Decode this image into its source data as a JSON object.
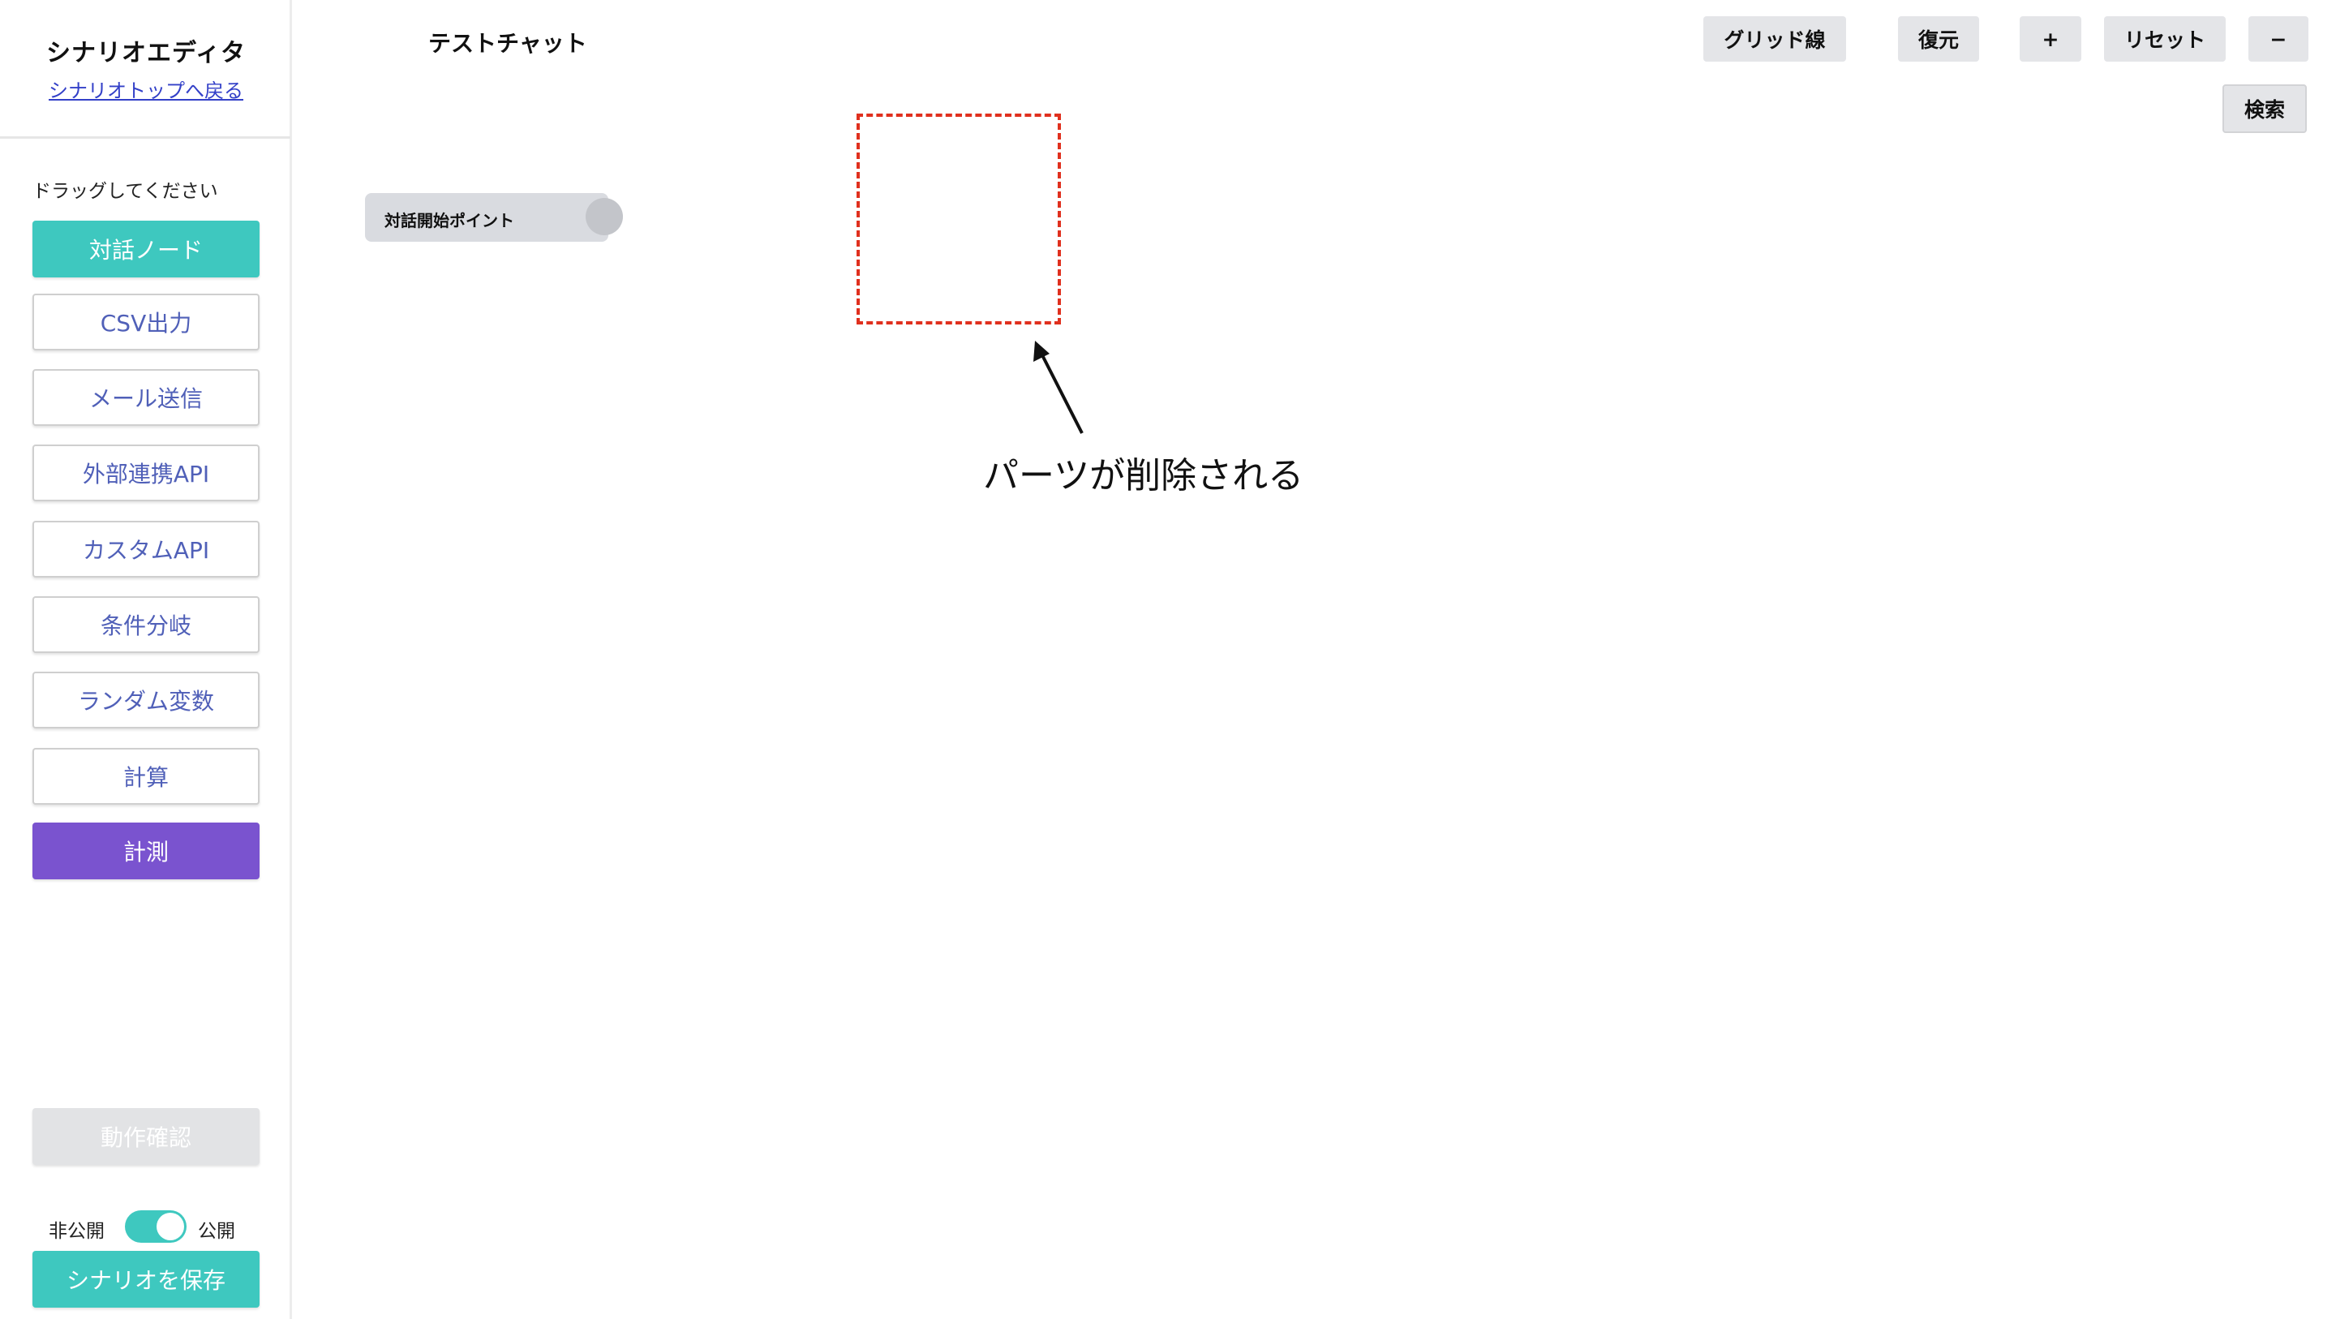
{
  "sidebar": {
    "title": "シナリオエディタ",
    "back_link": "シナリオトップへ戻る",
    "drag_hint": "ドラッグしてください",
    "palette": [
      {
        "label": "対話ノード",
        "style": "teal"
      },
      {
        "label": "CSV出力",
        "style": "outline"
      },
      {
        "label": "メール送信",
        "style": "outline"
      },
      {
        "label": "外部連携API",
        "style": "outline"
      },
      {
        "label": "カスタムAPI",
        "style": "outline"
      },
      {
        "label": "条件分岐",
        "style": "outline"
      },
      {
        "label": "ランダム変数",
        "style": "outline"
      },
      {
        "label": "計算",
        "style": "outline"
      },
      {
        "label": "計測",
        "style": "purple"
      }
    ],
    "run_check": "動作確認",
    "toggle": {
      "off_label": "非公開",
      "on_label": "公開",
      "state": "on"
    },
    "save_button": "シナリオを保存"
  },
  "header": {
    "chat_title": "テストチャット",
    "toolbar": {
      "grid": "グリッド線",
      "restore": "復元",
      "zoom_in": "+",
      "reset": "リセット",
      "zoom_out": "−",
      "search": "検索"
    }
  },
  "canvas": {
    "start_node": "対話開始ポイント",
    "annotation": "パーツが削除される"
  },
  "colors": {
    "teal": "#3ec8bf",
    "purple": "#7a53cf",
    "link": "#3340c8",
    "dashed_highlight": "#e0301e",
    "toolbar_bg": "#e4e5e8"
  }
}
